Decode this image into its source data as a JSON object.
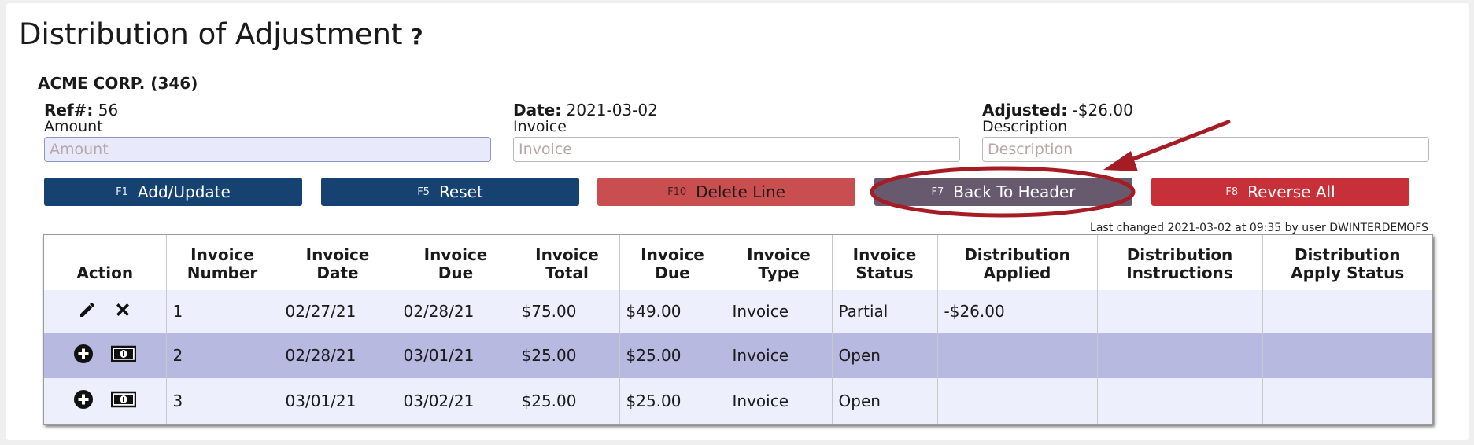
{
  "page": {
    "title": "Distribution of Adjustment",
    "help_glyph": "?",
    "company": "ACME CORP. (346)",
    "ref_label": "Ref#:",
    "ref_value": "56",
    "date_label": "Date:",
    "date_value": "2021-03-02",
    "adjusted_label": "Adjusted:",
    "adjusted_value": "-$26.00"
  },
  "fields": {
    "amount": {
      "label": "Amount",
      "placeholder": "Amount",
      "value": ""
    },
    "invoice": {
      "label": "Invoice",
      "placeholder": "Invoice",
      "value": ""
    },
    "description": {
      "label": "Description",
      "placeholder": "Description",
      "value": ""
    }
  },
  "buttons": {
    "add_update": {
      "key": "F1",
      "label": "Add/Update"
    },
    "reset": {
      "key": "F5",
      "label": "Reset"
    },
    "delete_line": {
      "key": "F10",
      "label": "Delete Line"
    },
    "back_to_header": {
      "key": "F7",
      "label": "Back To Header"
    },
    "reverse_all": {
      "key": "F8",
      "label": "Reverse All"
    }
  },
  "last_changed": "Last changed 2021-03-02 at 09:35 by user DWINTERDEMOFS",
  "table": {
    "headers": {
      "action": "Action",
      "inv_number_1": "Invoice",
      "inv_number_2": "Number",
      "inv_date_1": "Invoice",
      "inv_date_2": "Date",
      "inv_due_1": "Invoice",
      "inv_due_2": "Due",
      "inv_total_1": "Invoice",
      "inv_total_2": "Total",
      "inv_due_amt_1": "Invoice",
      "inv_due_amt_2": "Due",
      "inv_type_1": "Invoice",
      "inv_type_2": "Type",
      "inv_status_1": "Invoice",
      "inv_status_2": "Status",
      "dist_applied_1": "Distribution",
      "dist_applied_2": "Applied",
      "dist_instr_1": "Distribution",
      "dist_instr_2": "Instructions",
      "dist_apply_1": "Distribution",
      "dist_apply_2": "Apply Status"
    },
    "rows": [
      {
        "actions": [
          "pencil-icon",
          "close-x-icon"
        ],
        "number": "1",
        "date": "02/27/21",
        "due_date": "02/28/21",
        "total": "$75.00",
        "due": "$49.00",
        "type": "Invoice",
        "status": "Partial",
        "applied": "-$26.00",
        "instructions": "",
        "apply_status": ""
      },
      {
        "actions": [
          "plus-circle-icon",
          "money-icon"
        ],
        "number": "2",
        "date": "02/28/21",
        "due_date": "03/01/21",
        "total": "$25.00",
        "due": "$25.00",
        "type": "Invoice",
        "status": "Open",
        "applied": "",
        "instructions": "",
        "apply_status": ""
      },
      {
        "actions": [
          "plus-circle-icon",
          "money-icon"
        ],
        "number": "3",
        "date": "03/01/21",
        "due_date": "03/02/21",
        "total": "$25.00",
        "due": "$25.00",
        "type": "Invoice",
        "status": "Open",
        "applied": "",
        "instructions": "",
        "apply_status": ""
      }
    ]
  },
  "colors": {
    "primary_blue": "#154270",
    "delete_red": "#c94e50",
    "back_gray": "#675a6f",
    "reverse_red": "#c73038",
    "row_alt": "#b8b9e0",
    "row_light": "#eeeffc",
    "annotation_red": "#a51c24"
  }
}
